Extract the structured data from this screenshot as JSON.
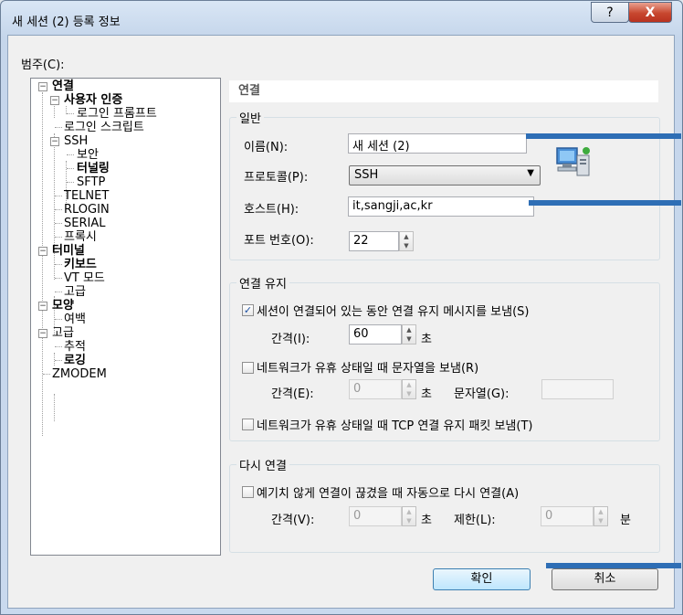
{
  "window": {
    "title": "새 세션 (2) 등록 정보",
    "help_glyph": "?",
    "close_glyph": "X"
  },
  "category": {
    "label": "범주(C):",
    "tree": [
      {
        "label": "연결",
        "bold": true,
        "expanded": true
      },
      {
        "label": "사용자 인증",
        "bold": true,
        "expanded": true
      },
      {
        "label": "로그인 프롬프트",
        "bold": false
      },
      {
        "label": "로그인 스크립트",
        "bold": false
      },
      {
        "label": "SSH",
        "bold": false,
        "expanded": true
      },
      {
        "label": "보안",
        "bold": false
      },
      {
        "label": "터널링",
        "bold": true
      },
      {
        "label": "SFTP",
        "bold": false
      },
      {
        "label": "TELNET",
        "bold": false
      },
      {
        "label": "RLOGIN",
        "bold": false
      },
      {
        "label": "SERIAL",
        "bold": false
      },
      {
        "label": "프록시",
        "bold": false
      },
      {
        "label": "터미널",
        "bold": true,
        "expanded": true
      },
      {
        "label": "키보드",
        "bold": true
      },
      {
        "label": "VT 모드",
        "bold": false
      },
      {
        "label": "고급",
        "bold": false
      },
      {
        "label": "모양",
        "bold": true,
        "expanded": true
      },
      {
        "label": "여백",
        "bold": false
      },
      {
        "label": "고급",
        "bold": false,
        "expanded": true
      },
      {
        "label": "추적",
        "bold": false
      },
      {
        "label": "로깅",
        "bold": true
      },
      {
        "label": "ZMODEM",
        "bold": false
      }
    ]
  },
  "section_title": "연결",
  "general": {
    "title": "일반",
    "name_label": "이름(N):",
    "name_value": "새 세션 (2)",
    "protocol_label": "프로토콜(P):",
    "protocol_value": "SSH",
    "host_label": "호스트(H):",
    "host_value": "it,sangji,ac,kr",
    "port_label": "포트 번호(O):",
    "port_value": "22"
  },
  "keepalive": {
    "title": "연결 유지",
    "send_keepalive_label": "세션이 연결되어 있는 동안 연결 유지 메시지를 보냄(S)",
    "send_keepalive_checked": true,
    "interval_label": "간격(I):",
    "interval_value": "60",
    "seconds_unit": "초",
    "idle_string_label": "네트워크가 유휴 상태일 때 문자열을 보냄(R)",
    "idle_string_checked": false,
    "interval2_label": "간격(E):",
    "interval2_value": "0",
    "seconds_unit2": "초",
    "string_label": "문자열(G):",
    "string_value": "",
    "tcp_keepalive_label": "네트워크가 유휴 상태일 때 TCP 연결 유지 패킷 보냄(T)",
    "tcp_keepalive_checked": false
  },
  "reconnect": {
    "title": "다시 연결",
    "auto_reconnect_label": "예기치 않게 연결이 끊겼을 때 자동으로 다시 연결(A)",
    "auto_reconnect_checked": false,
    "interval_label": "간격(V):",
    "interval_value": "0",
    "seconds_unit": "초",
    "limit_label": "제한(L):",
    "limit_value": "0",
    "minutes_unit": "분"
  },
  "buttons": {
    "ok_label": "확인",
    "cancel_label": "취소"
  },
  "colors": {
    "annotation_bar": "#2e6eb5"
  }
}
